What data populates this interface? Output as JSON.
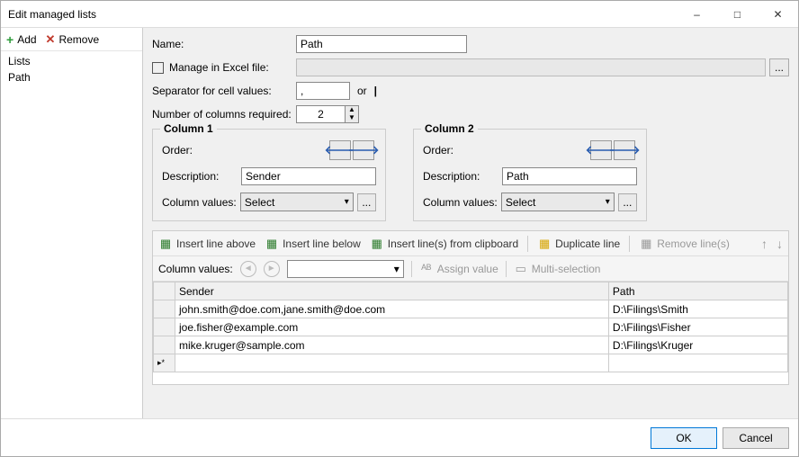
{
  "window": {
    "title": "Edit managed lists"
  },
  "sidebar": {
    "add": "Add",
    "remove": "Remove",
    "items": [
      "Lists",
      "Path"
    ]
  },
  "form": {
    "name_label": "Name:",
    "name_value": "Path",
    "manage_excel_label": "Manage in Excel file:",
    "excel_path": "",
    "browse": "...",
    "separator_label": "Separator for cell values:",
    "separator_value": ",",
    "or": "or",
    "pipe": "|",
    "numcols_label": "Number of columns required:",
    "numcols_value": "2"
  },
  "columns": [
    {
      "title": "Column 1",
      "order_label": "Order:",
      "desc_label": "Description:",
      "desc_value": "Sender",
      "cv_label": "Column values:",
      "cv_value": "Select"
    },
    {
      "title": "Column 2",
      "order_label": "Order:",
      "desc_label": "Description:",
      "desc_value": "Path",
      "cv_label": "Column values:",
      "cv_value": "Select"
    }
  ],
  "gridtb": {
    "insert_above": "Insert line above",
    "insert_below": "Insert line below",
    "insert_clip": "Insert line(s) from clipboard",
    "duplicate": "Duplicate line",
    "remove": "Remove line(s)"
  },
  "gridtb2": {
    "cv_label": "Column values:",
    "assign": "Assign value",
    "multi": "Multi-selection"
  },
  "grid": {
    "headers": [
      "Sender",
      "Path"
    ],
    "rows": [
      {
        "sender": "john.smith@doe.com,jane.smith@doe.com",
        "path": "D:\\Filings\\Smith"
      },
      {
        "sender": "joe.fisher@example.com",
        "path": "D:\\Filings\\Fisher"
      },
      {
        "sender": "mike.kruger@sample.com",
        "path": "D:\\Filings\\Kruger"
      }
    ],
    "newrow_marker": "▸*"
  },
  "footer": {
    "ok": "OK",
    "cancel": "Cancel"
  }
}
